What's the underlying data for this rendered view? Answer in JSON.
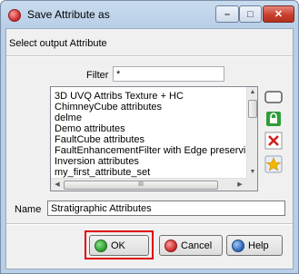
{
  "window": {
    "title": "Save Attribute as"
  },
  "header": {
    "select_label": "Select output Attribute"
  },
  "filter": {
    "label": "Filter",
    "value": "*"
  },
  "attribute_list": {
    "items": [
      "3D UVQ Attribs Texture + HC",
      "ChimneyCube attributes",
      "delme",
      "Demo attributes",
      "FaultCube attributes",
      "FaultEnhancementFilter with Edge preserving filter",
      "Inversion attributes",
      "my_first_attribute_set"
    ],
    "hscroll_grip": "III"
  },
  "name_field": {
    "label": "Name",
    "value": "Stratigraphic Attributes"
  },
  "buttons": {
    "ok": "OK",
    "cancel": "Cancel",
    "help": "Help"
  },
  "window_controls": {
    "minimize": "–",
    "maximize": "□",
    "close": "✕"
  },
  "colors": {
    "highlight_box": "#e00000",
    "accent": "#4a7fc1"
  }
}
